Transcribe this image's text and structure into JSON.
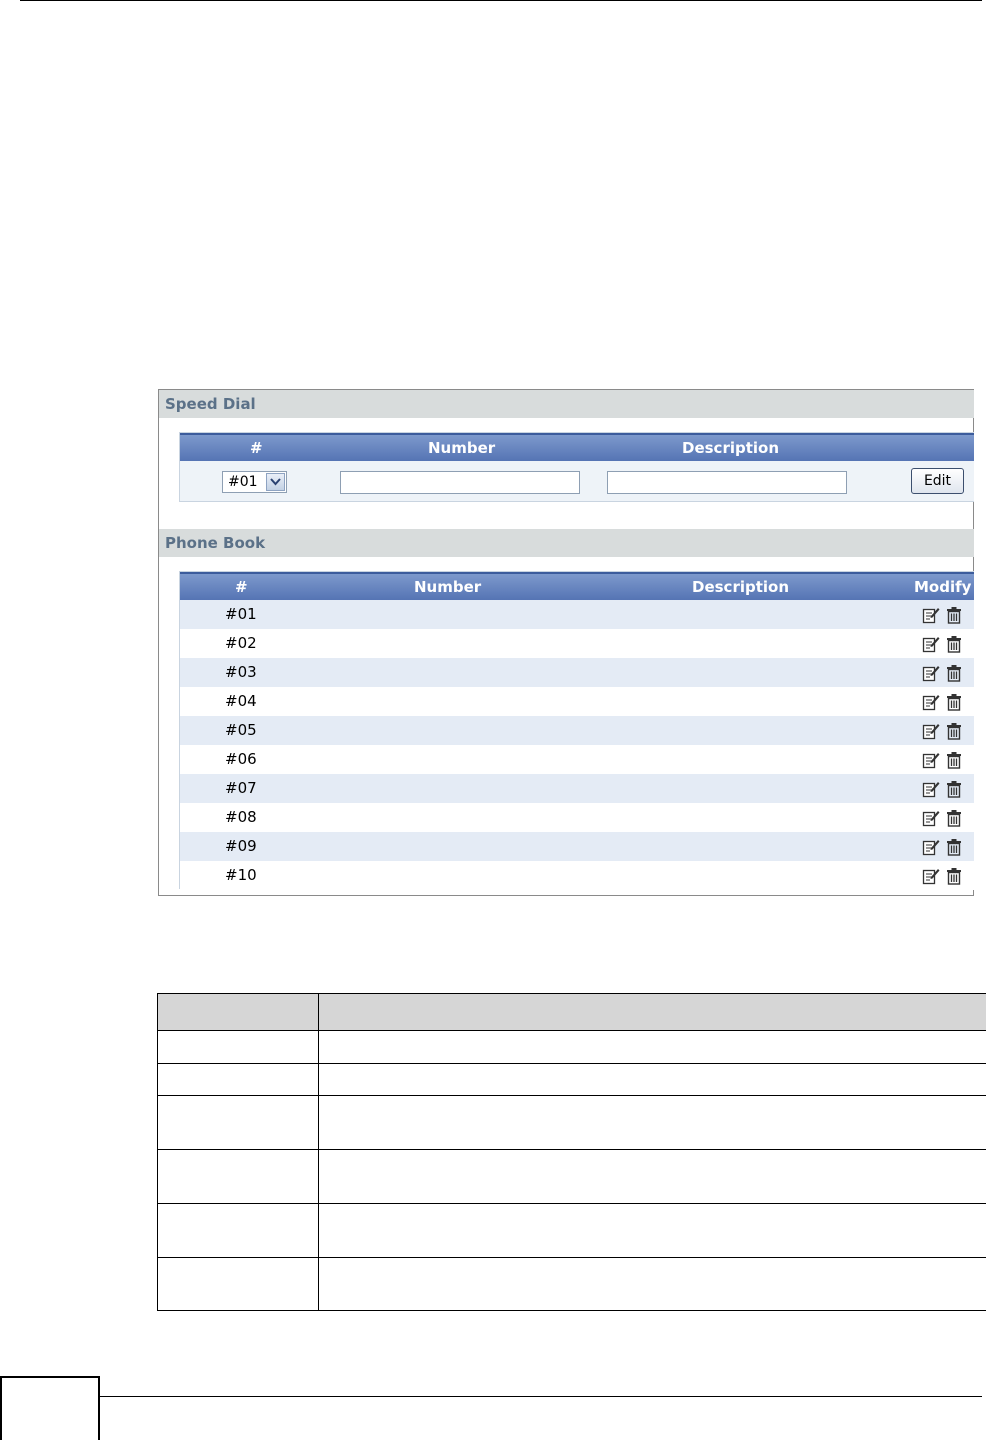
{
  "speed_dial": {
    "title": "Speed Dial",
    "columns": {
      "index": "#",
      "number": "Number",
      "description": "Description"
    },
    "selected_entry": "#01",
    "number_value": "",
    "description_value": "",
    "edit_label": "Edit"
  },
  "phone_book": {
    "title": "Phone Book",
    "columns": {
      "index": "#",
      "number": "Number",
      "description": "Description",
      "modify": "Modify"
    },
    "rows": [
      {
        "index": "#01"
      },
      {
        "index": "#02"
      },
      {
        "index": "#03"
      },
      {
        "index": "#04"
      },
      {
        "index": "#05"
      },
      {
        "index": "#06"
      },
      {
        "index": "#07"
      },
      {
        "index": "#08"
      },
      {
        "index": "#09"
      },
      {
        "index": "#10"
      }
    ]
  },
  "icons": {
    "edit": "edit-icon",
    "delete": "trash-icon",
    "dropdown": "chevron-down-icon"
  },
  "colors": {
    "header_blue": "#5574b4",
    "section_text": "#5b7188",
    "row_alt": "#e4ebf5"
  }
}
